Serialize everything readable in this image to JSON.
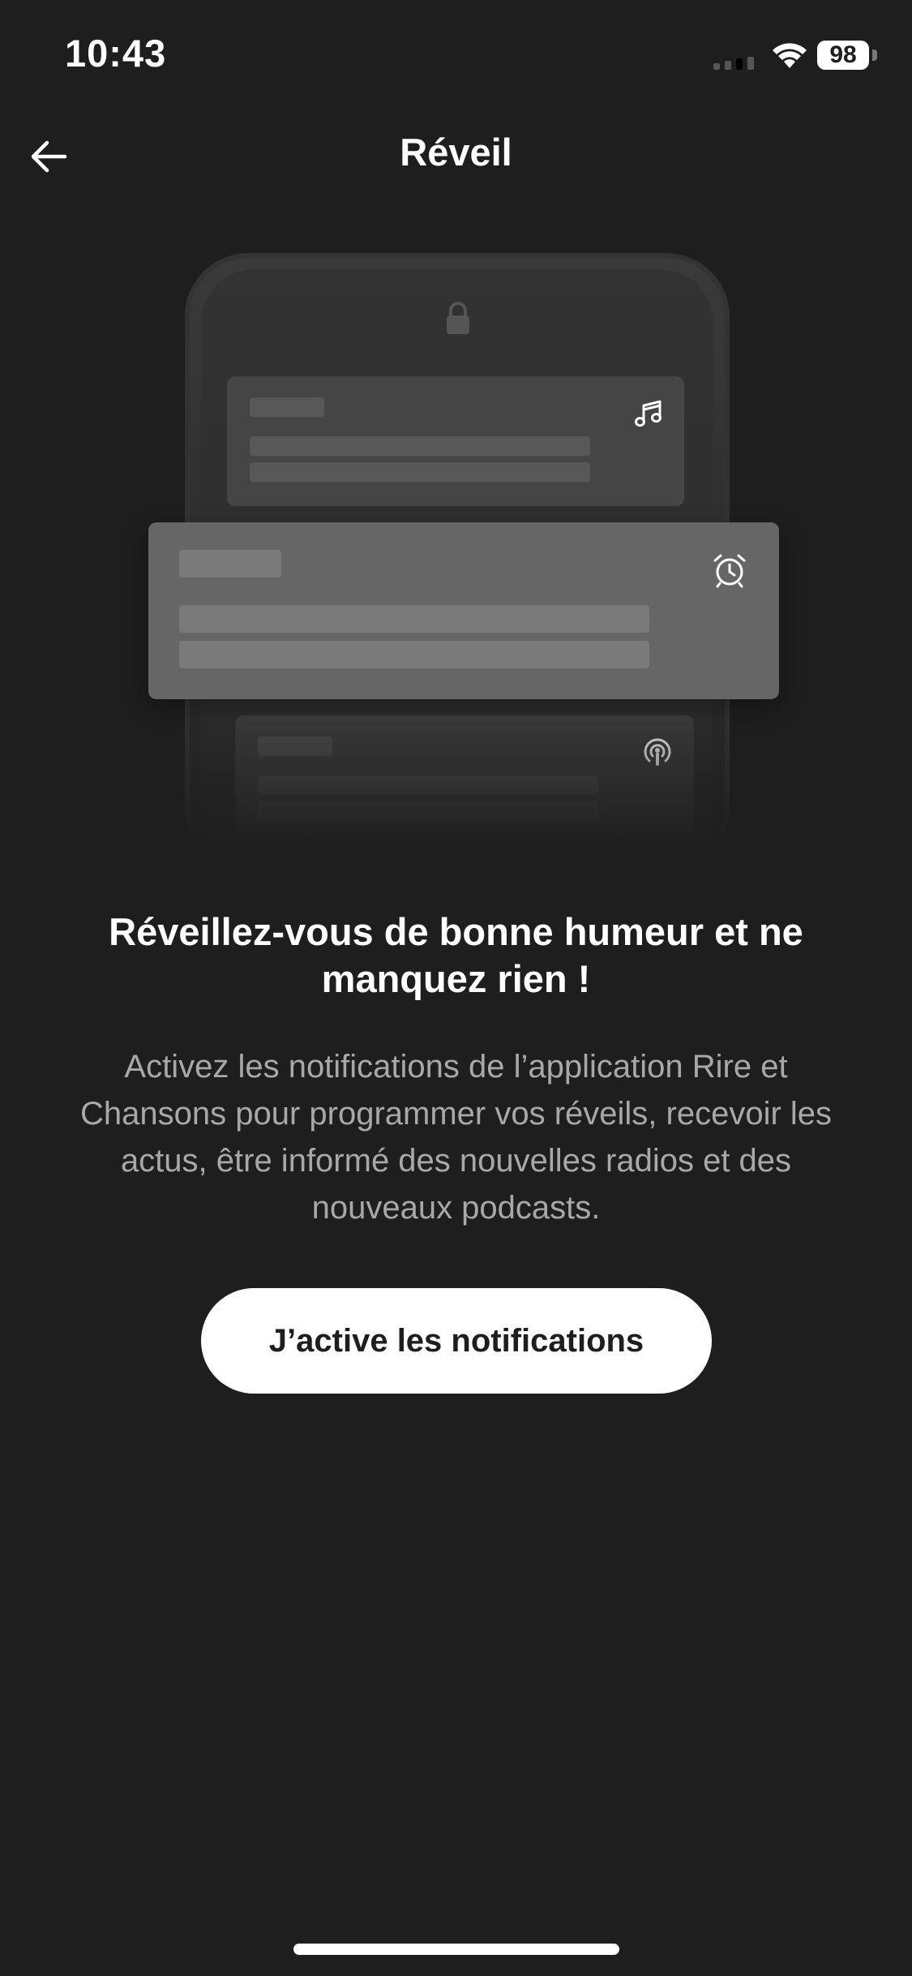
{
  "status_bar": {
    "time": "10:43",
    "battery": "98",
    "icons": [
      "signal-icon",
      "wifi-icon",
      "battery-icon"
    ]
  },
  "nav": {
    "back_icon": "arrow-left-icon",
    "title": "Réveil"
  },
  "illustration": {
    "icons": [
      "lock-icon",
      "music-note-icon",
      "alarm-clock-icon",
      "podcast-icon"
    ]
  },
  "content": {
    "headline": "Réveillez-vous de bonne humeur et ne manquez rien !",
    "description": "Activez les notifications de l’application Rire et Chansons pour programmer vos réveils, recevoir les actus, être informé des nouvelles radios et des nouveaux podcasts."
  },
  "cta": {
    "label": "J’active les notifications"
  },
  "colors": {
    "background": "#1e1e1e",
    "text_primary": "#ffffff",
    "text_secondary": "#a8a8a8",
    "button_background": "#ffffff",
    "button_text": "#1e1e1e"
  }
}
